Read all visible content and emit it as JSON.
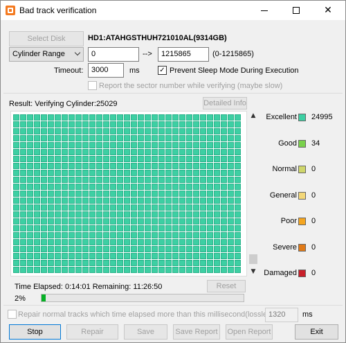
{
  "window": {
    "title": "Bad track verification"
  },
  "disk": {
    "select_label": "Select Disk",
    "name": "HD1:ATAHGSTHUH721010AL(9314GB)"
  },
  "range": {
    "mode": "Cylinder Range",
    "from": "0",
    "arrow": "-->",
    "to": "1215865",
    "hint": "(0-1215865)"
  },
  "timeout": {
    "label": "Timeout:",
    "value": "3000",
    "unit": "ms"
  },
  "options": {
    "prevent_sleep": "Prevent Sleep Mode During Execution",
    "report_sector": "Report the sector number while verifying (maybe slow)"
  },
  "result": {
    "text": "Result:  Verifying Cylinder:25029",
    "detail_button": "Detailed Info"
  },
  "grid": {
    "cell_count": 759,
    "cell_color": "#3dcfa3"
  },
  "legend": [
    {
      "name": "Excellent",
      "color": "#3dcfa3",
      "count": "24995"
    },
    {
      "name": "Good",
      "color": "#7ad14c",
      "count": "34"
    },
    {
      "name": "Normal",
      "color": "#cfd66b",
      "count": "0"
    },
    {
      "name": "General",
      "color": "#f3d778",
      "count": "0"
    },
    {
      "name": "Poor",
      "color": "#f4a520",
      "count": "0"
    },
    {
      "name": "Severe",
      "color": "#e07a17",
      "count": "0"
    },
    {
      "name": "Damaged",
      "color": "#c8202a",
      "count": "0"
    }
  ],
  "timing": {
    "text": "Time Elapsed:  0:14:01  Remaining:  11:26:50",
    "reset_button": "Reset",
    "percent": "2%",
    "progress": 0.02
  },
  "repair": {
    "label": "Repair normal tracks which time elapsed more than this millisecond(lossless):",
    "value": "1320",
    "unit": "ms"
  },
  "buttons": {
    "stop": "Stop",
    "repair": "Repair",
    "save": "Save",
    "save_report": "Save Report",
    "open_report": "Open Report",
    "exit": "Exit"
  }
}
